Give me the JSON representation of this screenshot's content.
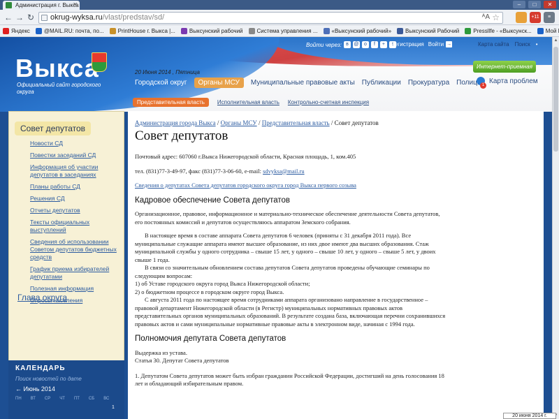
{
  "browser": {
    "tab_title": "Администрация г. Выкса /",
    "url_site": "okrug-wyksa.ru",
    "url_path": "/vlast/predstav/sd/",
    "bookmarks": [
      {
        "label": "Яндекс",
        "color": "#e02020"
      },
      {
        "label": "@MAIL.RU: почта, по...",
        "color": "#1b62c8"
      },
      {
        "label": "PrintHouse г. Выкса |...",
        "color": "#c8912a"
      },
      {
        "label": "Выксунский рабочий",
        "color": "#7a3ab0"
      },
      {
        "label": "Система управления ...",
        "color": "#888888"
      },
      {
        "label": "«Выксунский рабочий»",
        "color": "#4d6fb8"
      },
      {
        "label": "Выксунский Рабочий",
        "color": "#3b5998"
      },
      {
        "label": "Pressllfe - «Выксунск...",
        "color": "#2e9a3c"
      },
      {
        "label": "Мой Мир@Mail.Ru",
        "color": "#1b62c8"
      }
    ],
    "ext_badge": "+11"
  },
  "header": {
    "logo": "Выкса",
    "slogan": "Официальный сайт городского округа",
    "login_label": "Войти через:",
    "register": "Регистрация",
    "enter": "Войти",
    "sitemap": "Карта сайта",
    "search": "Поиск",
    "reception": "Интернет-приемная",
    "date": "20 Июня 2014 , Пятница",
    "problem_map": "Карта проблем",
    "problem_badge": "1"
  },
  "main_nav": [
    {
      "label": "Городской округ",
      "state": "normal"
    },
    {
      "label": "Органы МСУ",
      "state": "active"
    },
    {
      "label": "Муниципальные правовые акты",
      "state": "plain"
    },
    {
      "label": "Публикации",
      "state": "plain"
    },
    {
      "label": "Прокуратура",
      "state": "plain"
    },
    {
      "label": "Полиция",
      "state": "plain"
    }
  ],
  "sub_nav": [
    {
      "label": "Представительная власть",
      "active": true
    },
    {
      "label": "Исполнительная власть",
      "active": false
    },
    {
      "label": "Контрольно-счетная инспекция",
      "active": false
    }
  ],
  "sidebar": {
    "title": "Совет депутатов",
    "items": [
      "Новости СД",
      "Повестки заседаний СД",
      "Информация об участии депутатов в заседаниях",
      "Планы работы СД",
      "Решения СД",
      "Отчеты депутатов",
      "Тексты официальных выступлений",
      "Сведения об использовании Советом депутатов бюджетных средств",
      "График приема избирателей депутатами",
      "Полезная информация",
      "Опросы населения"
    ],
    "region_link": "Глава округа"
  },
  "calendar": {
    "title": "КАЛЕНДАРЬ",
    "hint": "Поиск новостей по дате",
    "month": "← Июнь 2014",
    "weekdays": [
      "ПН",
      "ВТ",
      "СР",
      "ЧТ",
      "ПТ",
      "СБ",
      "ВС"
    ],
    "first_day": "1"
  },
  "content": {
    "crumbs": [
      "Администрация города Выкса",
      "Органы МСУ",
      "Представительная власть"
    ],
    "crumb_current": "Совет депутатов",
    "title": "Совет депутатов",
    "address": "Почтовый адрес: 607060 г.Выкса  Нижегородской области,  Красная  площадь,  1,  ком.405",
    "phone": "тел. (831)77-3-49-97,  факс (831)77-3-06-60, e-mail: ",
    "email": "sdvyksa@mail.ru",
    "deputies_link": "Сведения о депутатах Совета депутатов городского округа город Выкса первого созыва",
    "section1": "Кадровое обеспечение Совета депутатов",
    "para1": "Организационное, правовое, информационное и материально-техническое обеспечение деятельности Совета депутатов, его постоянных комиссий и депутатов осуществляюсь аппаратом Земского собрания.",
    "para2": "В настоящее время в составе аппарата Совета депутатов 6 человек (приняты с 31 декабря 2011 года). Все муниципальные служащие аппарата имеют высшее образование, из них двое имеют два высших образования. Стаж муниципальной службы у одного сотрудника – свыше 15 лет, у одного – свыше 10 лет, у одного – свыше 5 лет, у двоих свыше  1 года.",
    "para3": "В  связи  со  значительным  обновлением  состава  депутатов  Совета депутатов          проведены обучающие  семинары по следующим вопросам:",
    "para4": "1) об  Уставе  городского  округа  город  Выкса  Нижегородской  области;",
    "para5": "2) о  бюджетном  процессе  в  городском  округе  город  Выкса.",
    "para6": "С августа 2011 года по настоящее время сотрудниками аппарата организовано направление в государственное – правовой департамент Нижегородской области (в Регистр) муниципальных нормативных правовых актов представительных органов муниципальных образований. В результате создана база, включающая перечни сохранившихся правовых актов и  сами муниципальные нормативные  правовые акты в электронном виде, начиная с 1994 года.",
    "section2": "Полномочия депутата Совета депутатов",
    "para7": "Выдержка из устава.",
    "para8": "Статья 30. Депутат  Совета депутатов",
    "para9": "1. Депутатом Совета депутатов может быть избран гражданин Российской Федерации, достигший на день голосования 18 лет и обладающий избирательным правом."
  },
  "taskbar": {
    "clock": "20 июня 2014 г."
  }
}
